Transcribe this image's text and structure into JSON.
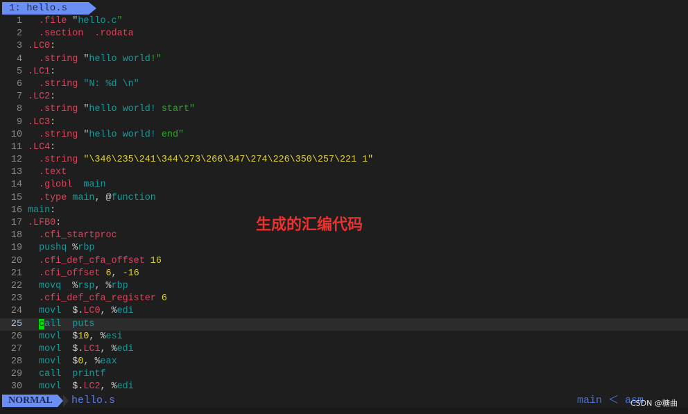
{
  "colors": {
    "kw": "#d9465e",
    "id": "#1a9a9a",
    "str": "#2ea82e",
    "num": "#e0d23c",
    "punct": "#c8c8c8",
    "accent": "#6b8ef5",
    "annotation": "#e8332f"
  },
  "tab": {
    "label": "1: hello.s"
  },
  "cursor_line": 25,
  "lines": [
    [
      [
        "  .file ",
        "kw"
      ],
      [
        "\"",
        "punct"
      ],
      [
        "hello.c",
        "id"
      ],
      [
        "\"",
        "str"
      ]
    ],
    [
      [
        "  .section  .rodata",
        "kw"
      ]
    ],
    [
      [
        ".LC0",
        "kw"
      ],
      [
        ":",
        "punct"
      ]
    ],
    [
      [
        "  .string ",
        "kw"
      ],
      [
        "\"",
        "punct"
      ],
      [
        "hello world",
        "id"
      ],
      [
        "!\"",
        "str"
      ]
    ],
    [
      [
        ".LC1",
        "kw"
      ],
      [
        ":",
        "punct"
      ]
    ],
    [
      [
        "  .string ",
        "kw"
      ],
      [
        "\"N: %d \\n\"",
        "id"
      ]
    ],
    [
      [
        ".LC2",
        "kw"
      ],
      [
        ":",
        "punct"
      ]
    ],
    [
      [
        "  .string ",
        "kw"
      ],
      [
        "\"",
        "punct"
      ],
      [
        "hello world! ",
        "id"
      ],
      [
        "start\"",
        "str"
      ]
    ],
    [
      [
        ".LC3",
        "kw"
      ],
      [
        ":",
        "punct"
      ]
    ],
    [
      [
        "  .string ",
        "kw"
      ],
      [
        "\"",
        "punct"
      ],
      [
        "hello world! ",
        "id"
      ],
      [
        "end\"",
        "str"
      ]
    ],
    [
      [
        ".LC4",
        "kw"
      ],
      [
        ":",
        "punct"
      ]
    ],
    [
      [
        "  .string ",
        "kw"
      ],
      [
        "\"\\346\\235\\241\\344\\273\\266\\347\\274\\226\\350\\257\\221 1\"",
        "num"
      ]
    ],
    [
      [
        "  .text",
        "kw"
      ]
    ],
    [
      [
        "  .globl  ",
        "kw"
      ],
      [
        "main",
        "id"
      ]
    ],
    [
      [
        "  .type ",
        "kw"
      ],
      [
        "main",
        "id"
      ],
      [
        ", @",
        "punct"
      ],
      [
        "function",
        "id"
      ]
    ],
    [
      [
        "main",
        "id"
      ],
      [
        ":",
        "punct"
      ]
    ],
    [
      [
        ".LFB0",
        "kw"
      ],
      [
        ":",
        "punct"
      ]
    ],
    [
      [
        "  .cfi_startproc",
        "kw"
      ]
    ],
    [
      [
        "  pushq ",
        "id"
      ],
      [
        "%",
        "punct"
      ],
      [
        "rbp",
        "id"
      ]
    ],
    [
      [
        "  .cfi_def_cfa_offset ",
        "kw"
      ],
      [
        "16",
        "num"
      ]
    ],
    [
      [
        "  .cfi_offset ",
        "kw"
      ],
      [
        "6",
        "num"
      ],
      [
        ", ",
        "punct"
      ],
      [
        "-16",
        "num"
      ]
    ],
    [
      [
        "  movq  ",
        "id"
      ],
      [
        "%",
        "punct"
      ],
      [
        "rsp",
        "id"
      ],
      [
        ", %",
        "punct"
      ],
      [
        "rbp",
        "id"
      ]
    ],
    [
      [
        "  .cfi_def_cfa_register ",
        "kw"
      ],
      [
        "6",
        "num"
      ]
    ],
    [
      [
        "  movl  ",
        "id"
      ],
      [
        "$.",
        "punct"
      ],
      [
        "LC0",
        "kw"
      ],
      [
        ", %",
        "punct"
      ],
      [
        "edi",
        "id"
      ]
    ],
    [
      [
        "  call  puts",
        "id"
      ]
    ],
    [
      [
        "  movl  ",
        "id"
      ],
      [
        "$",
        "punct"
      ],
      [
        "10",
        "num"
      ],
      [
        ", %",
        "punct"
      ],
      [
        "esi",
        "id"
      ]
    ],
    [
      [
        "  movl  ",
        "id"
      ],
      [
        "$.",
        "punct"
      ],
      [
        "LC1",
        "kw"
      ],
      [
        ", %",
        "punct"
      ],
      [
        "edi",
        "id"
      ]
    ],
    [
      [
        "  movl  ",
        "id"
      ],
      [
        "$",
        "punct"
      ],
      [
        "0",
        "num"
      ],
      [
        ", %",
        "punct"
      ],
      [
        "eax",
        "id"
      ]
    ],
    [
      [
        "  call  printf",
        "id"
      ]
    ],
    [
      [
        "  movl  ",
        "id"
      ],
      [
        "$.",
        "punct"
      ],
      [
        "LC2",
        "kw"
      ],
      [
        ", %",
        "punct"
      ],
      [
        "edi",
        "id"
      ]
    ]
  ],
  "annotation": "生成的汇编代码",
  "status": {
    "mode": "NORMAL",
    "filename": "hello.s",
    "right": "main ＜ asm",
    "watermark": "CSDN @糖曲"
  }
}
